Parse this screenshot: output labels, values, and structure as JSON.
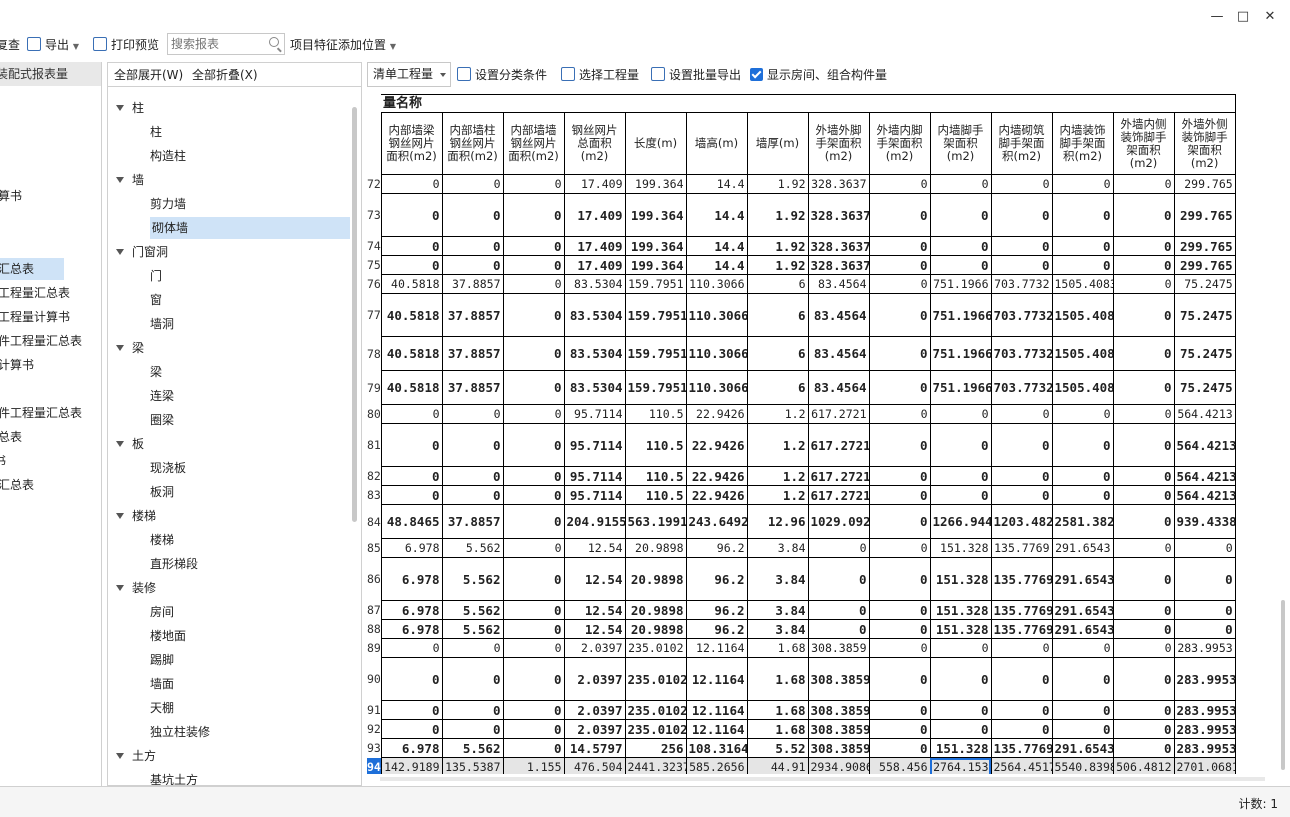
{
  "toolbar": {
    "check_label": "复查",
    "export_label": "导出",
    "print_preview_label": "打印预览",
    "search_placeholder": "搜索报表",
    "project_feature_label": "项目特征添加位置"
  },
  "left_panel": {
    "tab_label": "装配式报表量",
    "items": [
      "算书",
      "汇总表",
      "工程量汇总表",
      "工程量计算书",
      "件工程量汇总表",
      "计算书",
      "件工程量汇总表",
      "总表",
      "书",
      "汇总表"
    ]
  },
  "tree": {
    "expand_all": "全部展开(W)",
    "collapse_all": "全部折叠(X)",
    "groups": [
      {
        "label": "柱",
        "children": [
          "柱",
          "构造柱"
        ]
      },
      {
        "label": "墙",
        "children": [
          "剪力墙",
          "砌体墙"
        ]
      },
      {
        "label": "门窗洞",
        "children": [
          "门",
          "窗",
          "墙洞"
        ]
      },
      {
        "label": "梁",
        "children": [
          "梁",
          "连梁",
          "圈梁"
        ]
      },
      {
        "label": "板",
        "children": [
          "现浇板",
          "板洞"
        ]
      },
      {
        "label": "楼梯",
        "children": [
          "楼梯",
          "直形梯段"
        ]
      },
      {
        "label": "装修",
        "children": [
          "房间",
          "楼地面",
          "踢脚",
          "墙面",
          "天棚",
          "独立柱装修"
        ]
      },
      {
        "label": "土方",
        "children": [
          "基坑土方"
        ]
      }
    ],
    "selected": "砌体墙"
  },
  "grid_toolbar": {
    "combo_value": "清单工程量",
    "classify_label": "设置分类条件",
    "select_qty_label": "选择工程量",
    "batch_export_label": "设置批量导出",
    "show_rooms_label": "显示房间、组合构件量",
    "show_rooms_checked": true
  },
  "grid": {
    "group_header": "量名称",
    "columns": [
      "内部墙梁钢丝网片面积(m2)",
      "内部墙柱钢丝网片面积(m2)",
      "内部墙墙钢丝网片面积(m2)",
      "钢丝网片总面积(m2)",
      "长度(m)",
      "墙高(m)",
      "墙厚(m)",
      "外墙外脚手架面积(m2)",
      "外墙内脚手架面积(m2)",
      "内墙脚手架面积(m2)",
      "内墙砌筑脚手架面积(m2)",
      "内墙装饰脚手架面积(m2)",
      "外墙内侧装饰脚手架面积(m2)",
      "外墙外侧装饰脚手架面积(m2)"
    ],
    "rows": [
      {
        "n": "72",
        "style": "plain",
        "h": 19,
        "v": [
          "0",
          "0",
          "0",
          "17.409",
          "199.364",
          "14.4",
          "1.92",
          "328.3637",
          "0",
          "0",
          "0",
          "0",
          "0",
          "299.765"
        ]
      },
      {
        "n": "73",
        "style": "bold",
        "h": 43,
        "v": [
          "0",
          "0",
          "0",
          "17.409",
          "199.364",
          "14.4",
          "1.92",
          "328.3637",
          "0",
          "0",
          "0",
          "0",
          "0",
          "299.765"
        ]
      },
      {
        "n": "74",
        "style": "bold",
        "h": 19,
        "v": [
          "0",
          "0",
          "0",
          "17.409",
          "199.364",
          "14.4",
          "1.92",
          "328.3637",
          "0",
          "0",
          "0",
          "0",
          "0",
          "299.765"
        ]
      },
      {
        "n": "75",
        "style": "bold",
        "h": 19,
        "v": [
          "0",
          "0",
          "0",
          "17.409",
          "199.364",
          "14.4",
          "1.92",
          "328.3637",
          "0",
          "0",
          "0",
          "0",
          "0",
          "299.765"
        ]
      },
      {
        "n": "76",
        "style": "plain",
        "h": 19,
        "v": [
          "40.5818",
          "37.8857",
          "0",
          "83.5304",
          "159.7951",
          "110.3066",
          "6",
          "83.4564",
          "0",
          "751.1966",
          "703.7732",
          "1505.4083",
          "0",
          "75.2475"
        ]
      },
      {
        "n": "77",
        "style": "bold",
        "h": 43,
        "v": [
          "40.5818",
          "37.8857",
          "0",
          "83.5304",
          "159.7951",
          "110.3066",
          "6",
          "83.4564",
          "0",
          "751.1966",
          "703.7732",
          "1505.4083",
          "0",
          "75.2475"
        ]
      },
      {
        "n": "78",
        "style": "bold",
        "h": 34,
        "v": [
          "40.5818",
          "37.8857",
          "0",
          "83.5304",
          "159.7951",
          "110.3066",
          "6",
          "83.4564",
          "0",
          "751.1966",
          "703.7732",
          "1505.4083",
          "0",
          "75.2475"
        ]
      },
      {
        "n": "79",
        "style": "bold",
        "h": 34,
        "v": [
          "40.5818",
          "37.8857",
          "0",
          "83.5304",
          "159.7951",
          "110.3066",
          "6",
          "83.4564",
          "0",
          "751.1966",
          "703.7732",
          "1505.4083",
          "0",
          "75.2475"
        ]
      },
      {
        "n": "80",
        "style": "plain",
        "h": 19,
        "v": [
          "0",
          "0",
          "0",
          "95.7114",
          "110.5",
          "22.9426",
          "1.2",
          "617.2721",
          "0",
          "0",
          "0",
          "0",
          "0",
          "564.4213"
        ]
      },
      {
        "n": "81",
        "style": "bold",
        "h": 43,
        "v": [
          "0",
          "0",
          "0",
          "95.7114",
          "110.5",
          "22.9426",
          "1.2",
          "617.2721",
          "0",
          "0",
          "0",
          "0",
          "0",
          "564.4213"
        ]
      },
      {
        "n": "82",
        "style": "bold",
        "h": 19,
        "v": [
          "0",
          "0",
          "0",
          "95.7114",
          "110.5",
          "22.9426",
          "1.2",
          "617.2721",
          "0",
          "0",
          "0",
          "0",
          "0",
          "564.4213"
        ]
      },
      {
        "n": "83",
        "style": "bold",
        "h": 19,
        "v": [
          "0",
          "0",
          "0",
          "95.7114",
          "110.5",
          "22.9426",
          "1.2",
          "617.2721",
          "0",
          "0",
          "0",
          "0",
          "0",
          "564.4213"
        ]
      },
      {
        "n": "84",
        "style": "bold",
        "h": 34,
        "v": [
          "48.8465",
          "37.8857",
          "0",
          "204.9155",
          "563.1991",
          "243.6492",
          "12.96",
          "1029.0922",
          "0",
          "1266.9442",
          "1203.4822",
          "2581.3825",
          "0",
          "939.4338"
        ]
      },
      {
        "n": "85",
        "style": "plain",
        "h": 19,
        "v": [
          "6.978",
          "5.562",
          "0",
          "12.54",
          "20.9898",
          "96.2",
          "3.84",
          "0",
          "0",
          "151.328",
          "135.7769",
          "291.6543",
          "0",
          "0"
        ]
      },
      {
        "n": "86",
        "style": "bold",
        "h": 43,
        "v": [
          "6.978",
          "5.562",
          "0",
          "12.54",
          "20.9898",
          "96.2",
          "3.84",
          "0",
          "0",
          "151.328",
          "135.7769",
          "291.6543",
          "0",
          "0"
        ]
      },
      {
        "n": "87",
        "style": "bold",
        "h": 19,
        "v": [
          "6.978",
          "5.562",
          "0",
          "12.54",
          "20.9898",
          "96.2",
          "3.84",
          "0",
          "0",
          "151.328",
          "135.7769",
          "291.6543",
          "0",
          "0"
        ]
      },
      {
        "n": "88",
        "style": "bold",
        "h": 19,
        "v": [
          "6.978",
          "5.562",
          "0",
          "12.54",
          "20.9898",
          "96.2",
          "3.84",
          "0",
          "0",
          "151.328",
          "135.7769",
          "291.6543",
          "0",
          "0"
        ]
      },
      {
        "n": "89",
        "style": "plain",
        "h": 19,
        "v": [
          "0",
          "0",
          "0",
          "2.0397",
          "235.0102",
          "12.1164",
          "1.68",
          "308.3859",
          "0",
          "0",
          "0",
          "0",
          "0",
          "283.9953"
        ]
      },
      {
        "n": "90",
        "style": "bold",
        "h": 43,
        "v": [
          "0",
          "0",
          "0",
          "2.0397",
          "235.0102",
          "12.1164",
          "1.68",
          "308.3859",
          "0",
          "0",
          "0",
          "0",
          "0",
          "283.9953"
        ]
      },
      {
        "n": "91",
        "style": "bold",
        "h": 19,
        "v": [
          "0",
          "0",
          "0",
          "2.0397",
          "235.0102",
          "12.1164",
          "1.68",
          "308.3859",
          "0",
          "0",
          "0",
          "0",
          "0",
          "283.9953"
        ]
      },
      {
        "n": "92",
        "style": "bold",
        "h": 19,
        "v": [
          "0",
          "0",
          "0",
          "2.0397",
          "235.0102",
          "12.1164",
          "1.68",
          "308.3859",
          "0",
          "0",
          "0",
          "0",
          "0",
          "283.9953"
        ]
      },
      {
        "n": "93",
        "style": "bold",
        "h": 19,
        "v": [
          "6.978",
          "5.562",
          "0",
          "14.5797",
          "256",
          "108.3164",
          "5.52",
          "308.3859",
          "0",
          "151.328",
          "135.7769",
          "291.6543",
          "0",
          "283.9953"
        ]
      },
      {
        "n": "94",
        "style": "sum",
        "h": 19,
        "v": [
          "142.9189",
          "135.5387",
          "1.155",
          "476.504",
          "2441.3237",
          "585.2656",
          "44.91",
          "2934.9086",
          "558.456",
          "2764.153",
          "2564.4517",
          "5540.8398",
          "506.4812",
          "2701.0681"
        ]
      }
    ],
    "focused_cell": {
      "row": "94",
      "col": 9
    }
  },
  "status": {
    "count_label": "计数: 1"
  },
  "colors": {
    "accent": "#1e6fd9",
    "selection": "#cfe3f7",
    "sum_row": "#e5e5e5"
  }
}
